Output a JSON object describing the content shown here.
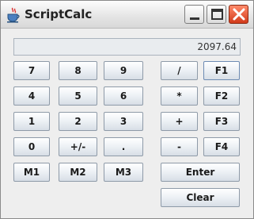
{
  "window": {
    "title": "ScriptCalc"
  },
  "display": {
    "value": "2097.64"
  },
  "keypad": {
    "row1": [
      "7",
      "8",
      "9"
    ],
    "row2": [
      "4",
      "5",
      "6"
    ],
    "row3": [
      "1",
      "2",
      "3"
    ],
    "row4": [
      "0",
      "+/-",
      "."
    ],
    "row5": [
      "M1",
      "M2",
      "M3"
    ]
  },
  "operators": [
    "/",
    "*",
    "+",
    "-"
  ],
  "functions": [
    "F1",
    "F2",
    "F3",
    "F4"
  ],
  "actions": {
    "enter": "Enter",
    "clear": "Clear"
  },
  "icons": {
    "app": "java-coffee-cup-icon",
    "minimize": "minimize-icon",
    "maximize": "maximize-icon",
    "close": "close-icon"
  }
}
